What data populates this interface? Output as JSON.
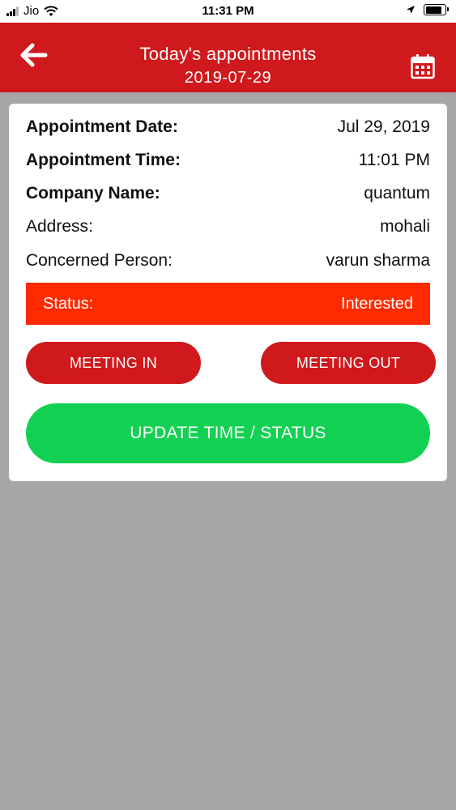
{
  "status_bar": {
    "carrier": "Jio",
    "time": "11:31 PM",
    "battery_level": 0.85
  },
  "header": {
    "title": "Today's appointments",
    "date": "2019-07-29",
    "back_icon": "arrow-left-icon",
    "calendar_icon": "calendar-icon"
  },
  "appointment": {
    "fields": [
      {
        "label": "Appointment Date:",
        "value": "Jul 29, 2019"
      },
      {
        "label": "Appointment Time:",
        "value": "11:01 PM"
      },
      {
        "label": "Company Name:",
        "value": "quantum"
      },
      {
        "label": "Address:",
        "value": "mohali"
      },
      {
        "label": "Concerned Person:",
        "value": "varun sharma"
      }
    ],
    "status_label": "Status:",
    "status_value": "Interested"
  },
  "actions": {
    "meeting_in": "MEETING IN",
    "meeting_out": "MEETING OUT",
    "update": "UPDATE TIME / STATUS"
  },
  "colors": {
    "header": "#d0191c",
    "status": "#ff2a00",
    "meeting_buttons": "#d0191c",
    "update_button": "#12d152",
    "background": "#a6a5a8"
  }
}
